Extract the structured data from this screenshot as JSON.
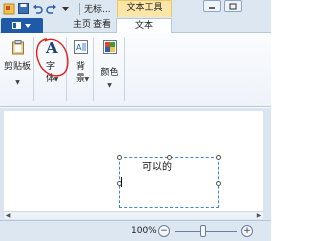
{
  "titlebar": {
    "title": "无标...",
    "context_tab": "文本工具"
  },
  "tabs": {
    "home": "主页",
    "view": "查看",
    "text": "文本"
  },
  "ribbon": {
    "clipboard": "剪贴板",
    "font_line1": "字",
    "font_line2": "体",
    "background_line1": "背",
    "background_line2": "景",
    "colors": "颜色"
  },
  "canvas": {
    "textbox_text": "可以的"
  },
  "status": {
    "zoom": "100%",
    "zoom_minus": "−",
    "zoom_plus": "+"
  },
  "colors": {
    "accent": "#1e5aa8",
    "context_tab": "#fbe6a8",
    "selection": "#3f86d4",
    "annotation": "#e0201b"
  }
}
